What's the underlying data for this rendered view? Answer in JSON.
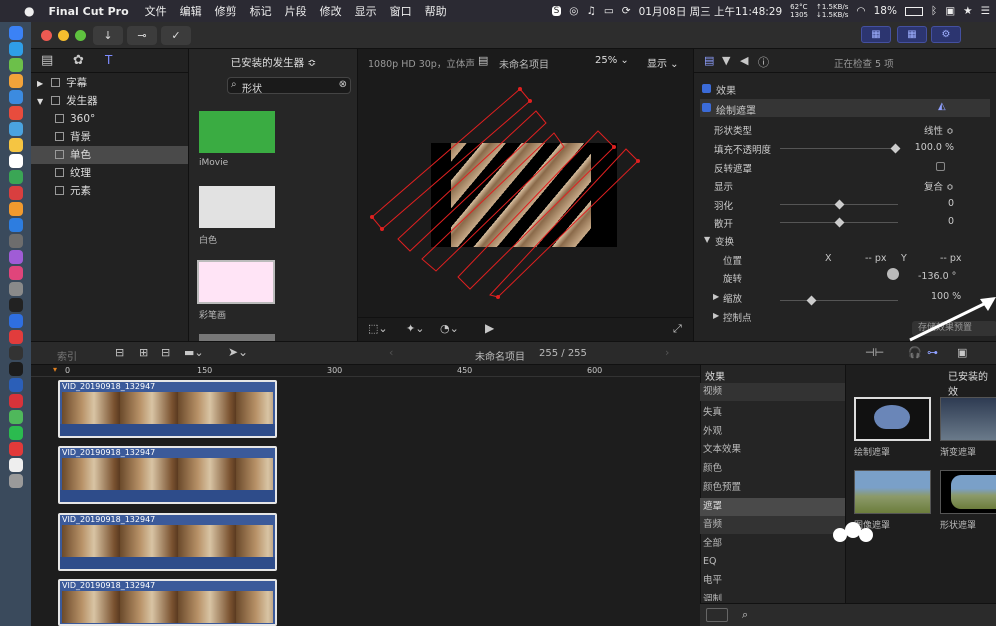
{
  "menubar": {
    "app_name": "Final Cut Pro",
    "menus": [
      "文件",
      "编辑",
      "修剪",
      "标记",
      "片段",
      "修改",
      "显示",
      "窗口",
      "帮助"
    ],
    "status": {
      "temp_line1": "62°C",
      "temp_line2": "1305",
      "net_up": "↑1.5KB/s",
      "net_down": "↓1.5KB/s",
      "datetime": "01月08日 周三 上午11:48:29",
      "battery": "18%"
    }
  },
  "toolbar": {
    "import_icon": "download-arrow-icon",
    "key_icon": "key-icon",
    "check_icon": "checkmark-icon"
  },
  "browser": {
    "dropdown": "已安装的发生器 ≎",
    "search_value": "形状",
    "categories": [
      {
        "label": "字幕",
        "arrow": "▶"
      },
      {
        "label": "发生器",
        "arrow": "▼"
      },
      {
        "label": "360°"
      },
      {
        "label": "背景"
      },
      {
        "label": "单色"
      },
      {
        "label": "纹理"
      },
      {
        "label": "元素"
      }
    ],
    "thumbnails": [
      {
        "label": "iMovie",
        "color": "#3aac42"
      },
      {
        "label": "白色",
        "color": "#e2e2e2"
      },
      {
        "label": "彩笔画",
        "color": "#ffe4f6"
      }
    ]
  },
  "viewer": {
    "format": "1080p HD 30p，立体声",
    "project": "未命名项目",
    "zoom": "25% ⌄",
    "display": "显示 ⌄"
  },
  "inspector": {
    "header": "正在检查 5 项",
    "effects_label": "效果",
    "effect_name": "绘制遮罩",
    "rows": [
      {
        "k": "形状类型",
        "v": "线性 ≎"
      },
      {
        "k": "填充不透明度",
        "v": "100.0 %"
      },
      {
        "k": "反转遮罩",
        "v": ""
      },
      {
        "k": "显示",
        "v": "复合 ≎"
      },
      {
        "k": "羽化",
        "v": "0"
      },
      {
        "k": "散开",
        "v": "0"
      }
    ],
    "transform_label": "变换",
    "position_label": "位置",
    "x_label": "X",
    "x_value": "-- px",
    "y_label": "Y",
    "y_value": "-- px",
    "rotation_label": "旋转",
    "rotation_value": "-136.0 °",
    "scale_label": "缩放",
    "scale_value": "100 %",
    "control_points_label": "控制点",
    "save_preset": "存储效果预置"
  },
  "timeline_bar": {
    "index_label": "索引",
    "project": "未命名项目",
    "counter": "255 / 255",
    "ruler": [
      "0",
      "150",
      "300",
      "450",
      "600"
    ]
  },
  "clips": [
    {
      "name": "VID_20190918_132947"
    },
    {
      "name": "VID_20190918_132947"
    },
    {
      "name": "VID_20190918_132947"
    },
    {
      "name": "VID_20190918_132947"
    }
  ],
  "effects_browser": {
    "title": "效果",
    "installed": "已安装的效",
    "categories": [
      "视频",
      "失真",
      "外观",
      "文本效果",
      "颜色",
      "颜色预置",
      "遮罩",
      "音频",
      "全部",
      "EQ",
      "电平",
      "调制"
    ],
    "selected": "遮罩",
    "thumbs": [
      {
        "label": "绘制遮罩"
      },
      {
        "label": "渐变遮罩"
      },
      {
        "label": "图像遮罩"
      },
      {
        "label": "形状遮罩"
      }
    ]
  }
}
